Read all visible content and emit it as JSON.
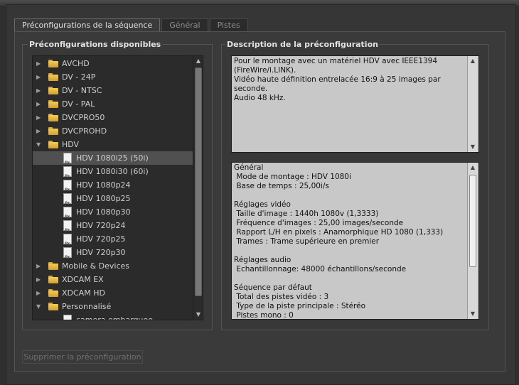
{
  "tabs": [
    {
      "label": "Préconfigurations de la séquence",
      "active": true
    },
    {
      "label": "Général",
      "active": false
    },
    {
      "label": "Pistes",
      "active": false
    }
  ],
  "presets_panel": {
    "title": "Préconfigurations disponibles",
    "items": [
      {
        "type": "folder",
        "label": "AVCHD",
        "expanded": false,
        "level": 0
      },
      {
        "type": "folder",
        "label": "DV - 24P",
        "expanded": false,
        "level": 0
      },
      {
        "type": "folder",
        "label": "DV - NTSC",
        "expanded": false,
        "level": 0
      },
      {
        "type": "folder",
        "label": "DV - PAL",
        "expanded": false,
        "level": 0
      },
      {
        "type": "folder",
        "label": "DVCPRO50",
        "expanded": false,
        "level": 0
      },
      {
        "type": "folder",
        "label": "DVCPROHD",
        "expanded": false,
        "level": 0
      },
      {
        "type": "folder",
        "label": "HDV",
        "expanded": true,
        "level": 0
      },
      {
        "type": "file",
        "label": "HDV 1080i25 (50i)",
        "selected": true,
        "level": 1
      },
      {
        "type": "file",
        "label": "HDV 1080i30 (60i)",
        "level": 1
      },
      {
        "type": "file",
        "label": "HDV 1080p24",
        "level": 1
      },
      {
        "type": "file",
        "label": "HDV 1080p25",
        "level": 1
      },
      {
        "type": "file",
        "label": "HDV 1080p30",
        "level": 1
      },
      {
        "type": "file",
        "label": "HDV 720p24",
        "level": 1
      },
      {
        "type": "file",
        "label": "HDV 720p25",
        "level": 1
      },
      {
        "type": "file",
        "label": "HDV 720p30",
        "level": 1
      },
      {
        "type": "folder",
        "label": "Mobile & Devices",
        "expanded": false,
        "level": 0
      },
      {
        "type": "folder",
        "label": "XDCAM EX",
        "expanded": false,
        "level": 0
      },
      {
        "type": "folder",
        "label": "XDCAM HD",
        "expanded": false,
        "level": 0
      },
      {
        "type": "folder",
        "label": "Personnalisé",
        "expanded": true,
        "level": 0
      },
      {
        "type": "file",
        "label": "camera embarquee",
        "level": 1
      }
    ]
  },
  "description_panel": {
    "title": "Description de la préconfiguration",
    "summary": "Pour le montage avec un matériel HDV avec IEEE1394\n(FireWire/i.LINK).\nVidéo haute définition entrelacée 16:9 à 25 images par seconde.\nAudio 48 kHz.",
    "details": "Général\n Mode de montage : HDV 1080i\n Base de temps : 25,00i/s\n\nRéglages vidéo\n Taille d'image : 1440h 1080v (1,3333)\n Fréquence d'images : 25,00 images/seconde\n Rapport L/H en pixels : Anamorphique HD 1080 (1,333)\n Trames : Trame supérieure en premier\n\nRéglages audio\n Echantillonnage: 48000 échantillons/seconde\n\nSéquence par défaut\n Total des pistes vidéo : 3\n Type de la piste principale : Stéréo\n Pistes mono : 0"
  },
  "buttons": {
    "delete_preset": "Supprimer la préconfiguration"
  }
}
